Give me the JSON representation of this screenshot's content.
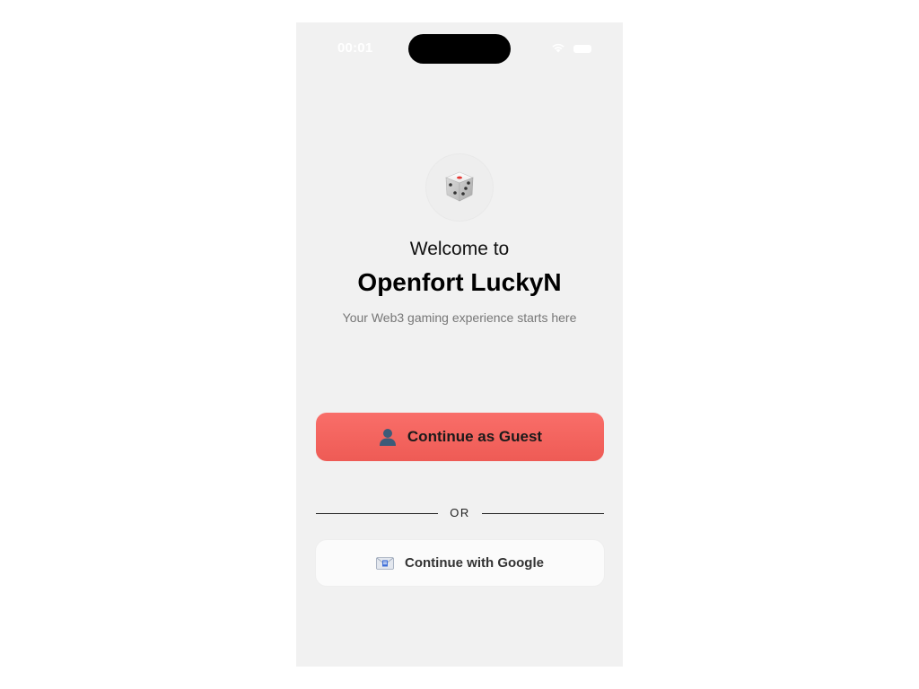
{
  "status_bar": {
    "time": "00:01",
    "icons": [
      "wifi-icon",
      "battery-icon"
    ]
  },
  "hero": {
    "icon": "dice-icon",
    "welcome": "Welcome to",
    "title": "Openfort LuckyN",
    "subtitle": "Your Web3 gaming experience starts here"
  },
  "actions": {
    "guest_label": "Continue as Guest",
    "guest_icon": "person-silhouette-icon",
    "divider_text": "OR",
    "google_label": "Continue with Google",
    "google_icon": "envelope-icon"
  },
  "colors": {
    "background": "#f1f1f1",
    "primary_button": "#f4635e",
    "secondary_button": "#fbfbfb",
    "text_primary": "#000000",
    "text_secondary": "#777777"
  }
}
